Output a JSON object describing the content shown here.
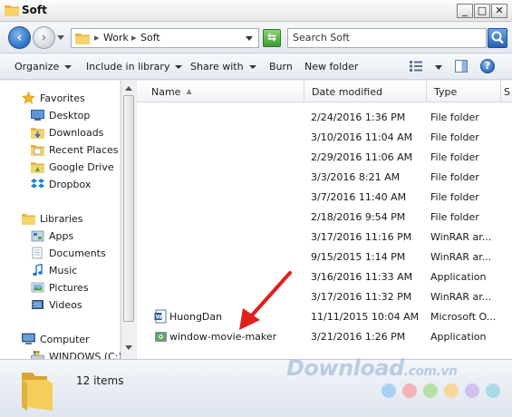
{
  "window": {
    "title": "Soft",
    "controls": {
      "minimize": "_",
      "maximize": "□",
      "close": "✕"
    }
  },
  "address": {
    "breadcrumbs": [
      "Work",
      "Soft"
    ],
    "separator": "▸",
    "search_placeholder": "Search Soft"
  },
  "toolbar": {
    "organize": "Organize",
    "include_in_library": "Include in library",
    "share_with": "Share with",
    "burn": "Burn",
    "new_folder": "New folder",
    "help": "?"
  },
  "nav": {
    "favorites": {
      "label": "Favorites",
      "items": [
        "Desktop",
        "Downloads",
        "Recent Places",
        "Google Drive",
        "Dropbox"
      ]
    },
    "libraries": {
      "label": "Libraries",
      "items": [
        "Apps",
        "Documents",
        "Music",
        "Pictures",
        "Videos"
      ]
    },
    "computer": {
      "label": "Computer",
      "items": [
        "WINDOWS (C:)"
      ]
    }
  },
  "columns": {
    "name": "Name",
    "date_modified": "Date modified",
    "type": "Type",
    "size": "S"
  },
  "files": [
    {
      "name": "",
      "date": "2/24/2016 1:36 PM",
      "type": "File folder"
    },
    {
      "name": "",
      "date": "3/10/2016 11:04 AM",
      "type": "File folder"
    },
    {
      "name": "",
      "date": "2/29/2016 11:06 AM",
      "type": "File folder"
    },
    {
      "name": "",
      "date": "3/3/2016 8:21 AM",
      "type": "File folder"
    },
    {
      "name": "",
      "date": "3/7/2016 11:40 AM",
      "type": "File folder"
    },
    {
      "name": "",
      "date": "2/18/2016 9:54 PM",
      "type": "File folder"
    },
    {
      "name": "",
      "date": "3/17/2016 11:16 PM",
      "type": "WinRAR ar..."
    },
    {
      "name": "",
      "date": "9/15/2015 1:14 PM",
      "type": "WinRAR ar..."
    },
    {
      "name": "",
      "date": "3/16/2016 11:33 AM",
      "type": "Application"
    },
    {
      "name": "",
      "date": "3/17/2016 11:32 PM",
      "type": "WinRAR ar..."
    },
    {
      "name": "HuongDan",
      "date": "11/11/2015 10:04 AM",
      "type": "Microsoft O...",
      "icon": "word-doc-icon"
    },
    {
      "name": "window-movie-maker",
      "date": "3/21/2016 1:26 PM",
      "type": "Application",
      "icon": "installer-app-icon"
    }
  ],
  "status": {
    "item_count": "12 items"
  },
  "watermark": {
    "text": "Download",
    "tld": ".com.vn"
  },
  "colors": {
    "accent": "#2b6fc5",
    "annotation_arrow": "#e0201b",
    "folder": "#f2c94c"
  }
}
